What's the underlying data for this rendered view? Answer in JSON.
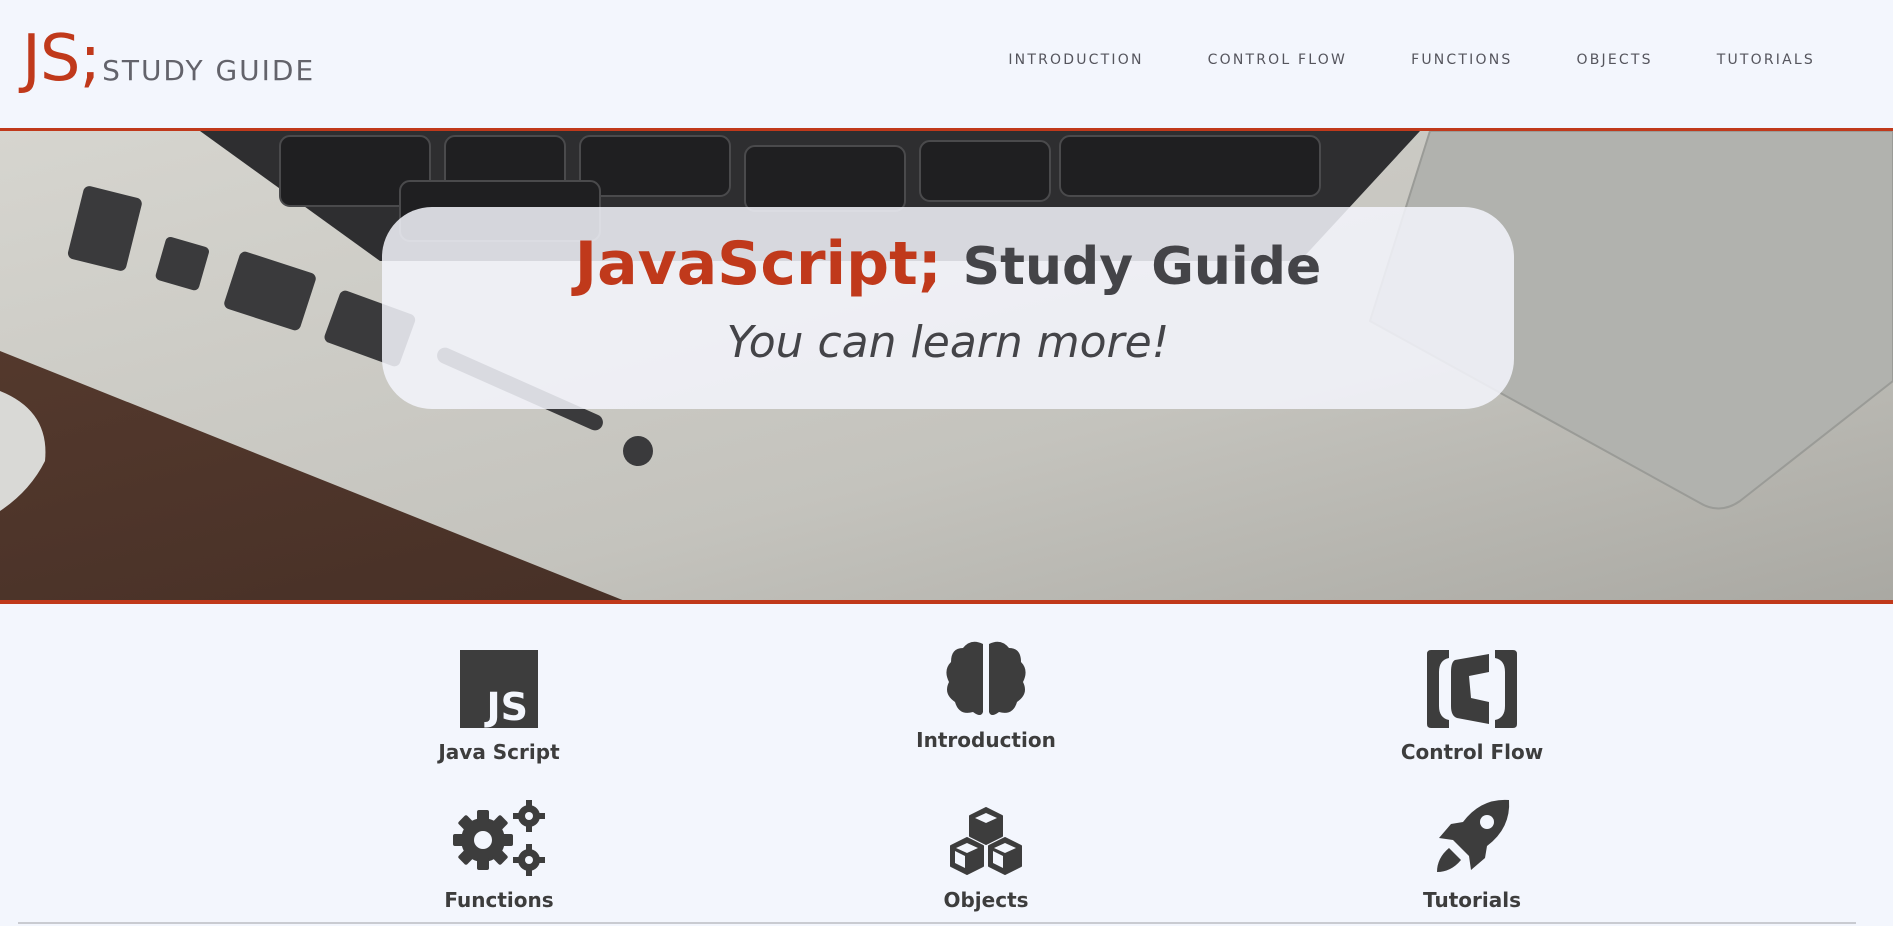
{
  "logo": {
    "mark": "JS;",
    "text": "STUDY GUIDE"
  },
  "nav": [
    "INTRODUCTION",
    "CONTROL FLOW",
    "FUNCTIONS",
    "OBJECTS",
    "TUTORIALS"
  ],
  "hero": {
    "title_accent": "JavaScript;",
    "title_rest": "Study Guide",
    "subtitle": "You can learn more!"
  },
  "features": [
    {
      "label": "Java Script",
      "icon": "js-icon"
    },
    {
      "label": "Introduction",
      "icon": "brain-icon"
    },
    {
      "label": "Control Flow",
      "icon": "brackets-icon"
    },
    {
      "label": "Functions",
      "icon": "gears-icon"
    },
    {
      "label": "Objects",
      "icon": "cubes-icon"
    },
    {
      "label": "Tutorials",
      "icon": "rocket-icon"
    }
  ],
  "colors": {
    "accent": "#c0391b",
    "background": "#f3f6fd",
    "text": "#3d3d3d"
  }
}
